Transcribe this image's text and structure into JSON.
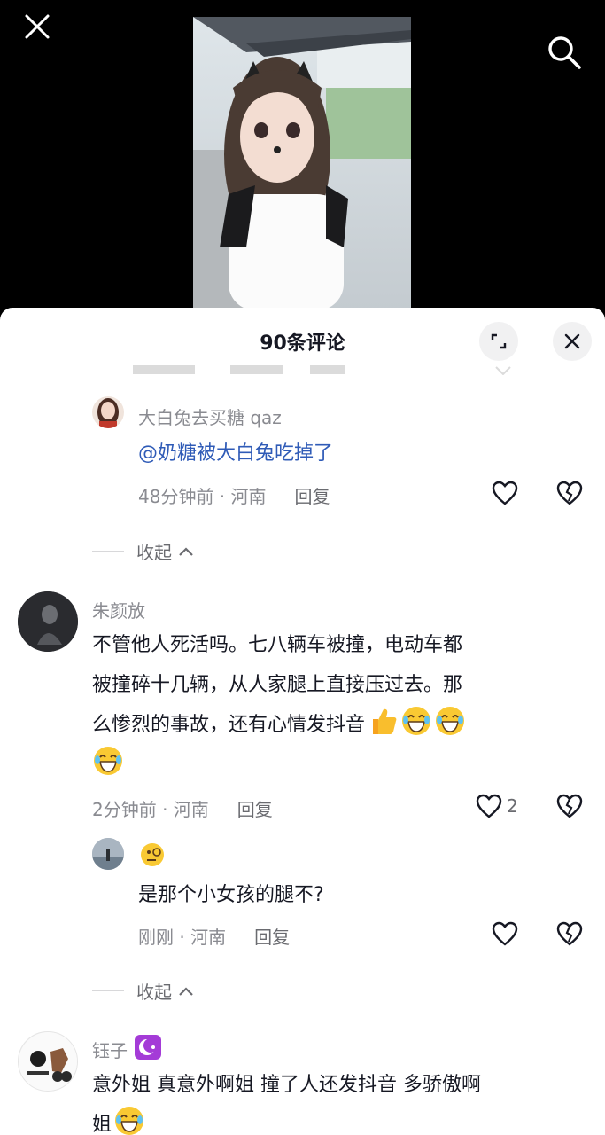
{
  "sheet": {
    "title": "90条评论"
  },
  "comments": [
    {
      "name": "大白兔去买糖 qaz",
      "mention": "@奶糖被大白兔吃掉了",
      "meta": "48分钟前 · 河南",
      "reply": "回复"
    },
    {
      "name": "朱颜放",
      "lines": [
        "不管他人死活吗。七八辆车被撞，电动车都",
        "被撞碎十几辆，从人家腿上直接压过去。那",
        "么惨烈的事故，还有心情发抖音"
      ],
      "meta": "2分钟前 · 河南",
      "reply": "回复",
      "likes": "2"
    },
    {
      "text": "是那个小女孩的腿不?",
      "meta": "刚刚 · 河南",
      "reply": "回复"
    },
    {
      "name": "钰子",
      "line": "意外姐 真意外啊姐 撞了人还发抖音 多骄傲啊",
      "line2": "姐"
    }
  ],
  "collapse": "收起",
  "colors": {
    "accent": "#2f5bb7",
    "badge": "#a43bd7"
  },
  "icons": [
    "close-icon",
    "search-icon",
    "expand-icon",
    "heart-icon",
    "dislike-icon",
    "thumbs-up-emoji",
    "laugh-cry-emoji"
  ]
}
